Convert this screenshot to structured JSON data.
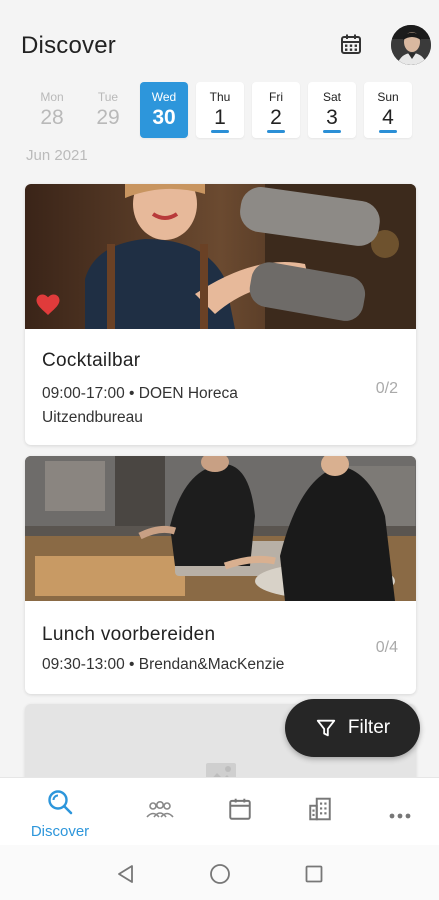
{
  "header": {
    "title": "Discover",
    "calendar_icon": "calendar-icon",
    "avatar": "user-avatar"
  },
  "dates": [
    {
      "name": "Mon",
      "num": "28",
      "state": "past"
    },
    {
      "name": "Tue",
      "num": "29",
      "state": "past"
    },
    {
      "name": "Wed",
      "num": "30",
      "state": "active"
    },
    {
      "name": "Thu",
      "num": "1",
      "state": "available"
    },
    {
      "name": "Fri",
      "num": "2",
      "state": "available"
    },
    {
      "name": "Sat",
      "num": "3",
      "state": "available"
    },
    {
      "name": "Sun",
      "num": "4",
      "state": "available"
    }
  ],
  "month_label": "Jun 2021",
  "cards": [
    {
      "title": "Cocktailbar",
      "meta": "09:00-17:00  •  DOEN Horeca Uitzendbureau",
      "count": "0/2",
      "favorite": true,
      "image": "bartender-photo"
    },
    {
      "title": "Lunch voorbereiden",
      "meta": "09:30-13:00  •  Brendan&MacKenzie",
      "count": "0/4",
      "favorite": false,
      "image": "kitchen-photo"
    }
  ],
  "filter": {
    "label": "Filter",
    "icon": "filter-icon"
  },
  "nav": {
    "items": [
      {
        "id": "discover",
        "label": "Discover",
        "icon": "search-icon",
        "active": true
      },
      {
        "id": "people",
        "icon": "people-icon"
      },
      {
        "id": "calendar",
        "icon": "calendar-icon"
      },
      {
        "id": "company",
        "icon": "building-icon"
      },
      {
        "id": "more",
        "icon": "more-icon"
      }
    ]
  },
  "colors": {
    "accent": "#2d96db",
    "heart": "#e03b3b",
    "fab": "#262626"
  }
}
